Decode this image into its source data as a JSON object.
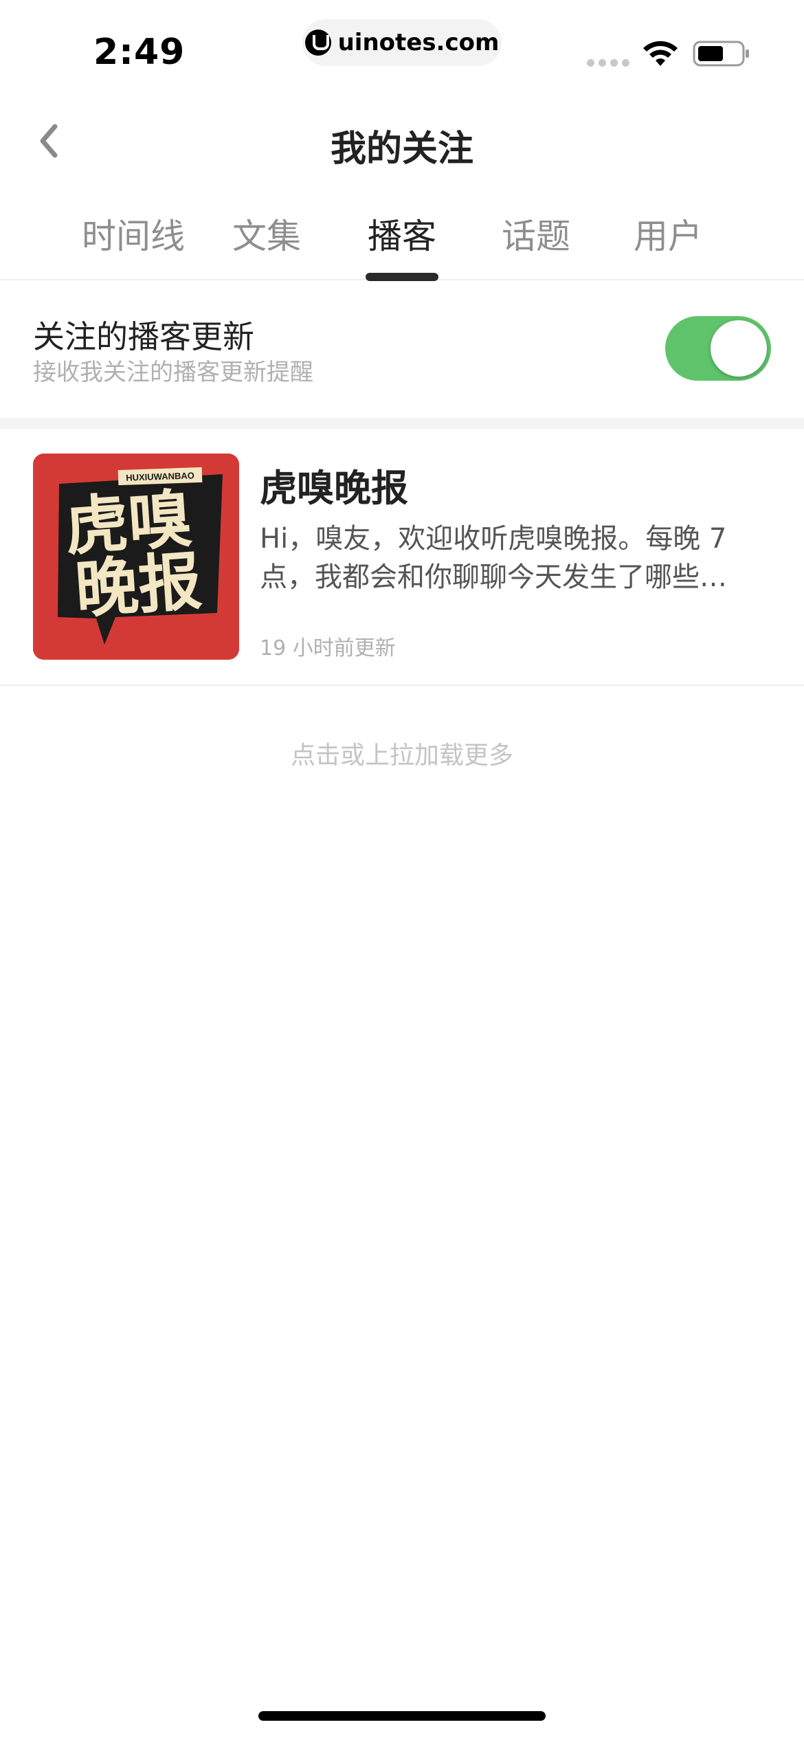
{
  "status_bar": {
    "time": "2:49",
    "url": "uinotes.com",
    "icons": [
      "signal-icon",
      "wifi-icon",
      "battery-icon"
    ]
  },
  "nav": {
    "back_icon": "chevron-left-icon",
    "title": "我的关注"
  },
  "tabs": [
    {
      "label": "时间线",
      "active": false
    },
    {
      "label": "文集",
      "active": false
    },
    {
      "label": "播客",
      "active": true
    },
    {
      "label": "话题",
      "active": false
    },
    {
      "label": "用户",
      "active": false
    }
  ],
  "setting": {
    "title": "关注的播客更新",
    "description": "接收我关注的播客更新提醒",
    "enabled": true
  },
  "podcasts": [
    {
      "name": "虎嗅晚报",
      "description": "Hi，嗅友，欢迎收听虎嗅晚报。每晚 7 点，我都会和你聊聊今天发生了哪些…",
      "updated": "19 小时前更新",
      "cover": {
        "tag": "HUXIUWANBAO",
        "line1": "虎嗅",
        "line2": "晚报"
      }
    }
  ],
  "load_more": "点击或上拉加载更多",
  "colors": {
    "toggle_on": "#5fc36b",
    "cover_background": "#d43a35",
    "cover_text": "#f3e6c2",
    "tab_active": "#222222",
    "tab_inactive": "#8e8e8e"
  }
}
